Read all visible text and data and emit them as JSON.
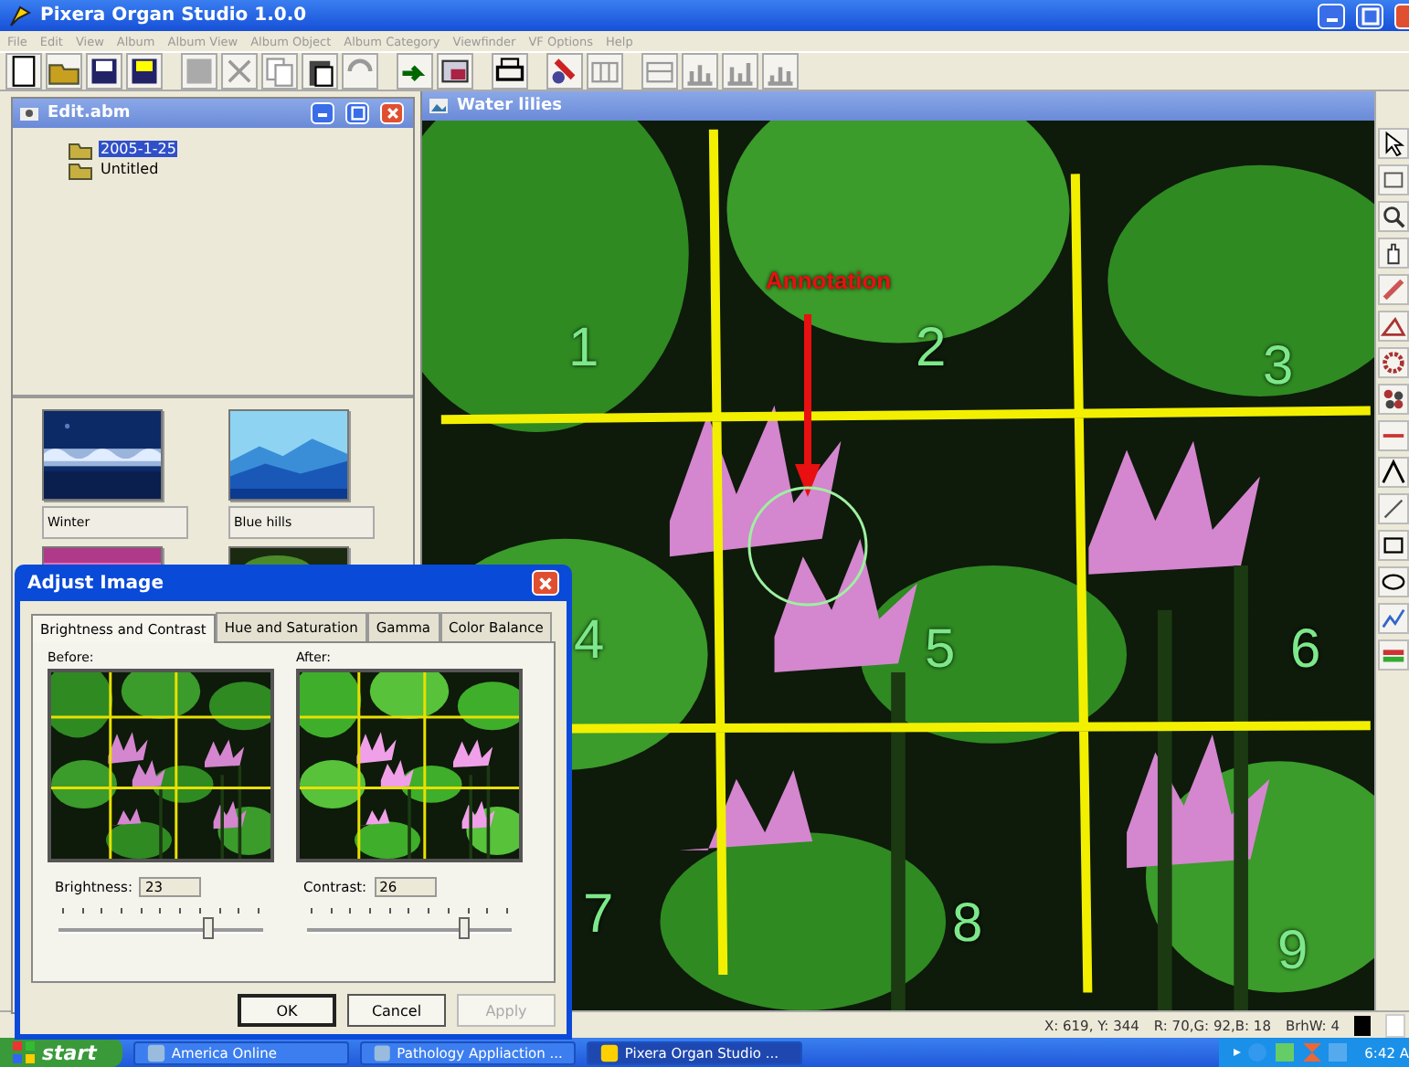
{
  "window": {
    "title": "Pixera Organ Studio 1.0.0"
  },
  "menu": [
    "File",
    "Edit",
    "View",
    "Album",
    "Album View",
    "Album Object",
    "Album Category",
    "Viewfinder",
    "VF Options",
    "Help"
  ],
  "album_panel": {
    "title": "Edit.abm",
    "tree": [
      {
        "label": "2005-1-25",
        "selected": true
      },
      {
        "label": "Untitled",
        "selected": false
      }
    ],
    "thumbnails": [
      {
        "label": "Winter",
        "kind": "winter"
      },
      {
        "label": "Blue hills",
        "kind": "hills"
      }
    ]
  },
  "image_window": {
    "title": "Water lilies",
    "annotation": "Annotation",
    "grid_numbers": [
      "1",
      "2",
      "3",
      "4",
      "5",
      "6",
      "7",
      "8",
      "9"
    ]
  },
  "dialog": {
    "title": "Adjust Image",
    "tabs": [
      {
        "label": "Brightness and Contrast",
        "selected": true
      },
      {
        "label": "Hue and Saturation",
        "selected": false
      },
      {
        "label": "Gamma",
        "selected": false
      },
      {
        "label": "Color Balance",
        "selected": false
      }
    ],
    "before_label": "Before:",
    "after_label": "After:",
    "sliders": [
      {
        "label": "Brightness:",
        "value": "23",
        "level": 0.73
      },
      {
        "label": "Contrast:",
        "value": "26",
        "level": 0.77
      }
    ],
    "buttons": [
      {
        "label": "OK",
        "disabled": false
      },
      {
        "label": "Cancel",
        "disabled": false
      },
      {
        "label": "Apply",
        "disabled": true
      }
    ]
  },
  "status_bar": [
    "X: 619, Y: 344",
    "R: 70,G: 92,B: 18",
    "BrhW: 4"
  ],
  "taskbar": {
    "start": "start",
    "tasks": [
      {
        "label": "America Online",
        "selected": false
      },
      {
        "label": "Pathology Appliaction ...",
        "selected": false
      },
      {
        "label": "Pixera Organ Studio ...",
        "selected": true
      }
    ],
    "clock": "6:42 A"
  }
}
